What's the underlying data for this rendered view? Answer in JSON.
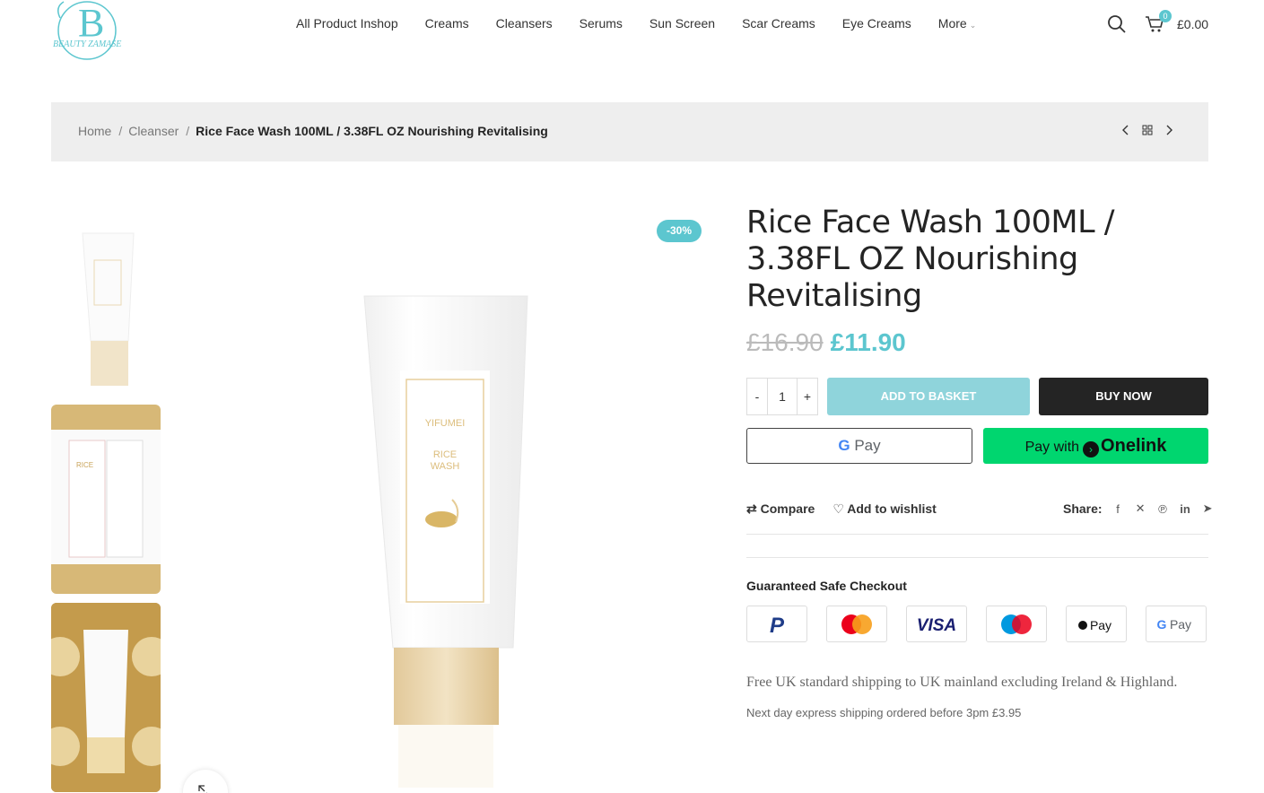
{
  "header": {
    "logo_text": "BEAUTY ZAMASE",
    "nav": [
      "All Product Inshop",
      "Creams",
      "Cleansers",
      "Serums",
      "Sun Screen",
      "Scar Creams",
      "Eye Creams",
      "More"
    ],
    "cart_count": "0",
    "cart_total": "£0.00",
    "icons": {
      "search": "search-icon",
      "cart": "cart-icon"
    }
  },
  "breadcrumb": {
    "home": "Home",
    "category": "Cleanser",
    "current": "Rice Face Wash 100ML / 3.38FL OZ Nourishing Revitalising"
  },
  "gallery": {
    "badge": "-30%",
    "product_label_brand": "YIFUMEI",
    "product_label_name": "RICE WASH"
  },
  "product": {
    "title": "Rice Face Wash 100ML / 3.38FL OZ Nourishing Revitalising",
    "old_price": "£16.90",
    "new_price": "£11.90",
    "qty_minus": "-",
    "qty_value": "1",
    "qty_plus": "+",
    "add_to_basket": "ADD TO BASKET",
    "buy_now": "BUY NOW",
    "gpay_g": "G",
    "gpay_label": "Pay",
    "onelink_prefix": "Pay with",
    "onelink_brand": "Onelink",
    "compare": "Compare",
    "wishlist": "Add to wishlist",
    "share_label": "Share:",
    "safe_checkout": "Guaranteed Safe Checkout",
    "payment_methods": [
      "PayPal",
      "Mastercard",
      "VISA",
      "Maestro",
      "Apple Pay",
      "G Pay"
    ],
    "shipping_note": "Free UK standard shipping to UK mainland excluding Ireland & Highland.",
    "express_note": "Next day express shipping ordered before 3pm £3.95"
  },
  "colors": {
    "accent": "#5cc6cf",
    "button_dark": "#242424",
    "onelink_green": "#00d66f",
    "crumb_bg": "#eeeeee"
  }
}
